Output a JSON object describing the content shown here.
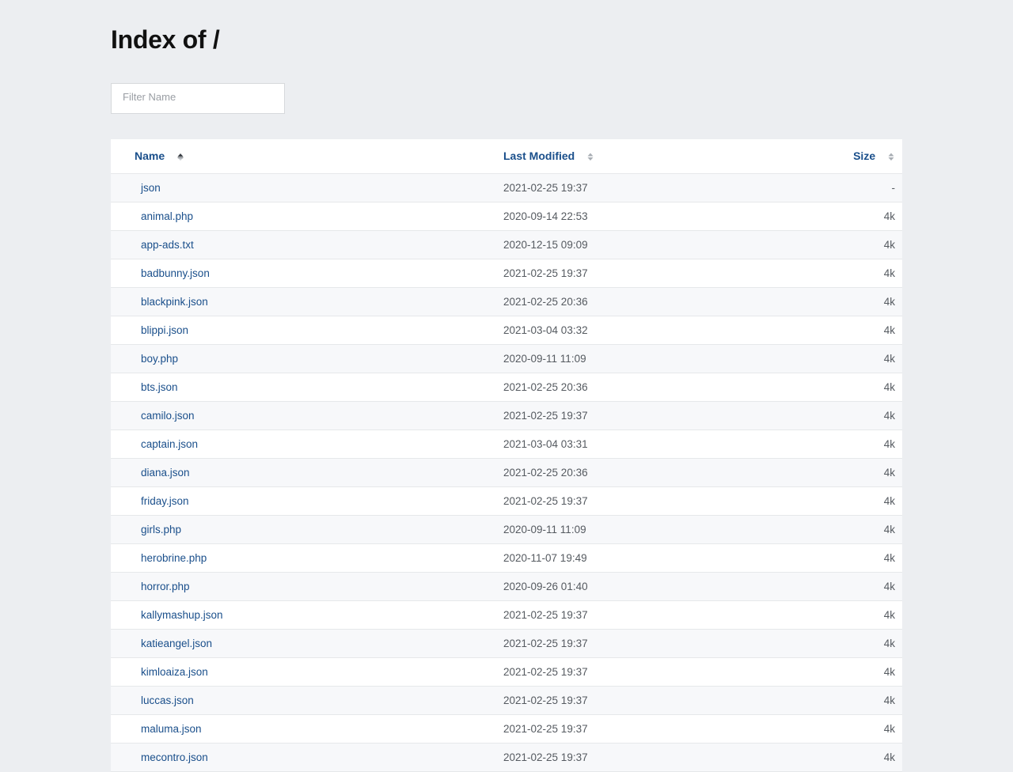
{
  "page": {
    "title": "Index of /"
  },
  "filter": {
    "placeholder": "Filter Name"
  },
  "table": {
    "headers": {
      "name": "Name",
      "modified": "Last Modified",
      "size": "Size"
    },
    "rows": [
      {
        "name": "json",
        "modified": "2021-02-25 19:37",
        "size": "-"
      },
      {
        "name": "animal.php",
        "modified": "2020-09-14 22:53",
        "size": "4k"
      },
      {
        "name": "app-ads.txt",
        "modified": "2020-12-15 09:09",
        "size": "4k"
      },
      {
        "name": "badbunny.json",
        "modified": "2021-02-25 19:37",
        "size": "4k"
      },
      {
        "name": "blackpink.json",
        "modified": "2021-02-25 20:36",
        "size": "4k"
      },
      {
        "name": "blippi.json",
        "modified": "2021-03-04 03:32",
        "size": "4k"
      },
      {
        "name": "boy.php",
        "modified": "2020-09-11 11:09",
        "size": "4k"
      },
      {
        "name": "bts.json",
        "modified": "2021-02-25 20:36",
        "size": "4k"
      },
      {
        "name": "camilo.json",
        "modified": "2021-02-25 19:37",
        "size": "4k"
      },
      {
        "name": "captain.json",
        "modified": "2021-03-04 03:31",
        "size": "4k"
      },
      {
        "name": "diana.json",
        "modified": "2021-02-25 20:36",
        "size": "4k"
      },
      {
        "name": "friday.json",
        "modified": "2021-02-25 19:37",
        "size": "4k"
      },
      {
        "name": "girls.php",
        "modified": "2020-09-11 11:09",
        "size": "4k"
      },
      {
        "name": "herobrine.php",
        "modified": "2020-11-07 19:49",
        "size": "4k"
      },
      {
        "name": "horror.php",
        "modified": "2020-09-26 01:40",
        "size": "4k"
      },
      {
        "name": "kallymashup.json",
        "modified": "2021-02-25 19:37",
        "size": "4k"
      },
      {
        "name": "katieangel.json",
        "modified": "2021-02-25 19:37",
        "size": "4k"
      },
      {
        "name": "kimloaiza.json",
        "modified": "2021-02-25 19:37",
        "size": "4k"
      },
      {
        "name": "luccas.json",
        "modified": "2021-02-25 19:37",
        "size": "4k"
      },
      {
        "name": "maluma.json",
        "modified": "2021-02-25 19:37",
        "size": "4k"
      },
      {
        "name": "mecontro.json",
        "modified": "2021-02-25 19:37",
        "size": "4k"
      }
    ]
  },
  "colors": {
    "background": "#eceef1",
    "link": "#1a4f8b",
    "row_alt": "#f7f8fa"
  },
  "icons": {
    "sort_active": "sort-ascending-icon",
    "sort_inactive": "sort-icon"
  }
}
